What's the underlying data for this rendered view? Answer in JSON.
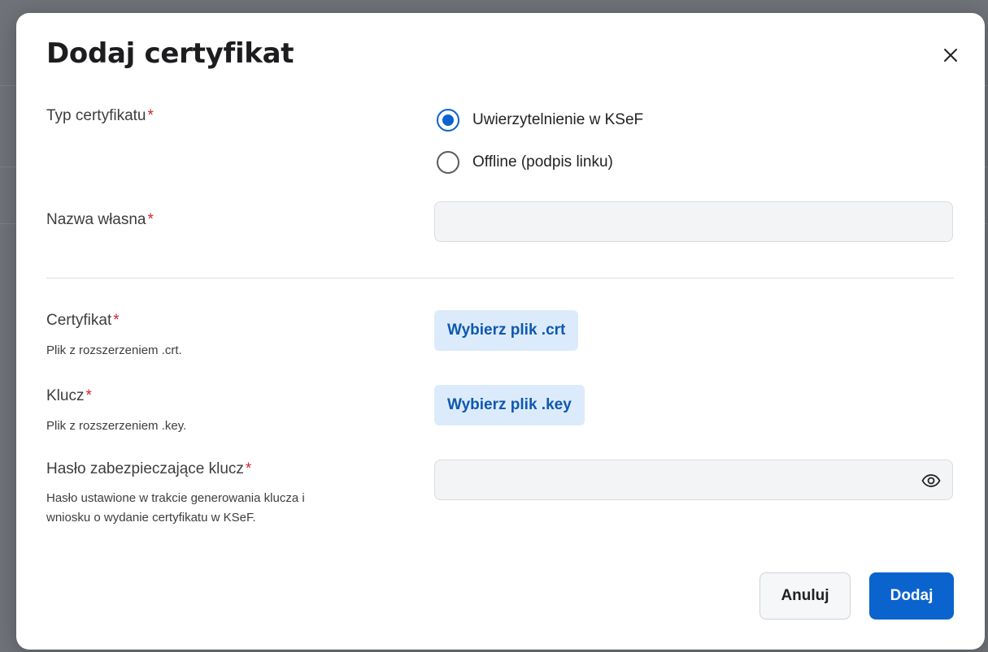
{
  "dialog": {
    "title": "Dodaj certyfikat",
    "close_icon": "close-icon"
  },
  "cert_type": {
    "label": "Typ certyfikatu",
    "required_mark": "*",
    "options": [
      {
        "label": "Uwierzytelnienie w KSeF",
        "selected": true
      },
      {
        "label": "Offline (podpis linku)",
        "selected": false
      }
    ]
  },
  "name_field": {
    "label": "Nazwa własna",
    "required_mark": "*",
    "value": ""
  },
  "certificate": {
    "label": "Certyfikat",
    "required_mark": "*",
    "hint": "Plik z rozszerzeniem .crt.",
    "button_label": "Wybierz plik .crt"
  },
  "key": {
    "label": "Klucz",
    "required_mark": "*",
    "hint": "Plik z rozszerzeniem .key.",
    "button_label": "Wybierz plik .key"
  },
  "password": {
    "label": "Hasło zabezpieczające klucz",
    "required_mark": "*",
    "hint_line1": "Hasło ustawione w trakcie generowania klucza i",
    "hint_line2": "wniosku o wydanie certyfikatu w KSeF.",
    "value": "",
    "toggle_icon": "eye-icon"
  },
  "footer": {
    "cancel_label": "Anuluj",
    "submit_label": "Dodaj"
  },
  "colors": {
    "primary": "#0b63ce",
    "required": "#d4232e",
    "file_button_bg": "#dcebfb"
  }
}
